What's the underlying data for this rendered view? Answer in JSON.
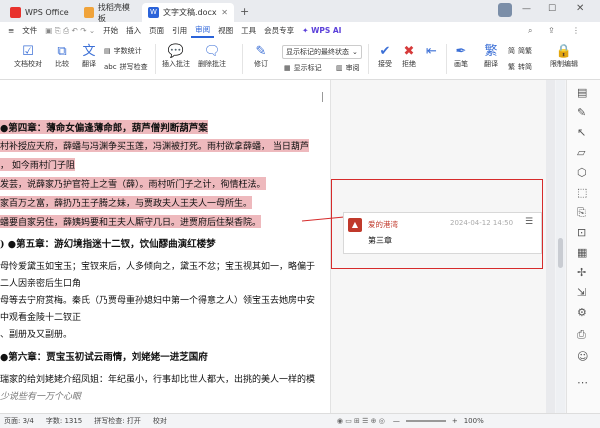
{
  "tabs": [
    {
      "label": "WPS Office",
      "active": false
    },
    {
      "label": "找稻壳模板",
      "active": false
    },
    {
      "label": "文字文稿.docx",
      "active": true
    }
  ],
  "menu": [
    "文件",
    "开始",
    "插入",
    "页面",
    "引用",
    "审阅",
    "视图",
    "工具",
    "会员专享",
    "WPS AI"
  ],
  "menu_active": "审阅",
  "ribbon": {
    "doc_check": "文档校对",
    "compare": "比较",
    "translate": "翻译",
    "word_count": "字数统计",
    "pinyin": "拼写检查",
    "insert_comment": "插入批注",
    "delete_comment": "删除批注",
    "revise": "修订",
    "show_markup_select": "显示标记的最终状态",
    "show_markup": "显示标记",
    "review": "审阅",
    "accept": "接受",
    "reject": "拒绝",
    "prev": "上一条",
    "next": "下一条",
    "draw": "画笔",
    "fan": "翻译",
    "simp": "简繁",
    "trad": "转简",
    "restrict": "限制编辑"
  },
  "document": {
    "lines": [
      {
        "text": "●第四章：薄命女偏逢薄命郎，葫芦僧判断葫芦案",
        "style": "heading-hl"
      },
      {
        "text": "村补授应天府，薛蟠与冯渊争买玉莲，冯渊被打死。雨村欲拿薛蟠，  当日葫芦",
        "style": "hl"
      },
      {
        "text": "，  如今雨村门子阻",
        "style": "hl"
      },
      {
        "text": "发芸，说薛家乃护官符上之雪（薛）。雨村听门子之计，徇情枉法。",
        "style": "hl"
      },
      {
        "text": "家百万之富，薛扔乃王子腾之妹，与贾政夫人王夫人一母所生。",
        "style": "hl"
      },
      {
        "text": "蟠要自家另住，薛姨妈要和王夫人厮守几日。进贾府后住梨香院。",
        "style": "hl"
      },
      {
        "text": ") ●第五章：游幻境指迷十二钗，饮仙醪曲演红楼梦",
        "style": "heading"
      },
      {
        "text": "母怜爱黛玉如宝玉；宝钗来后，人多倾向之，黛玉不忿；宝玉视其如一，略偏于",
        "style": "plain"
      },
      {
        "text": "二人因亲密后生口角",
        "style": "plain"
      },
      {
        "text": "母等去宁府赏梅。秦氏（乃贾母重孙媳妇中第一个得意之人）领宝玉去她房中安",
        "style": "plain"
      },
      {
        "text": "中观看金陵十二钗正",
        "style": "plain"
      },
      {
        "text": "、副册及又副册。",
        "style": "plain"
      },
      {
        "text": "●第六章：贾宝玉初试云雨情，刘姥姥一进芝国府",
        "style": "heading"
      },
      {
        "text": "瑞家的给刘姥姥介绍凤姐：年纪虽小，行事却比世人都大，出挑的美人一样的模",
        "style": "plain"
      },
      {
        "text": "少说些有一万个心眼",
        "style": "faded"
      }
    ]
  },
  "comment": {
    "author": "爱的港湾",
    "time": "2024-04-12 14:50",
    "text": "第三章"
  },
  "status": {
    "page": "页面: 3/4",
    "words": "字数: 1315",
    "spell": "拼写检查: 打开",
    "proof": "校对",
    "zoom": "100%"
  },
  "colors": {
    "accent": "#2b63d9",
    "highlight": "#eeb9bd",
    "comment_author": "#c0392b",
    "red_box": "#d62b2b"
  }
}
